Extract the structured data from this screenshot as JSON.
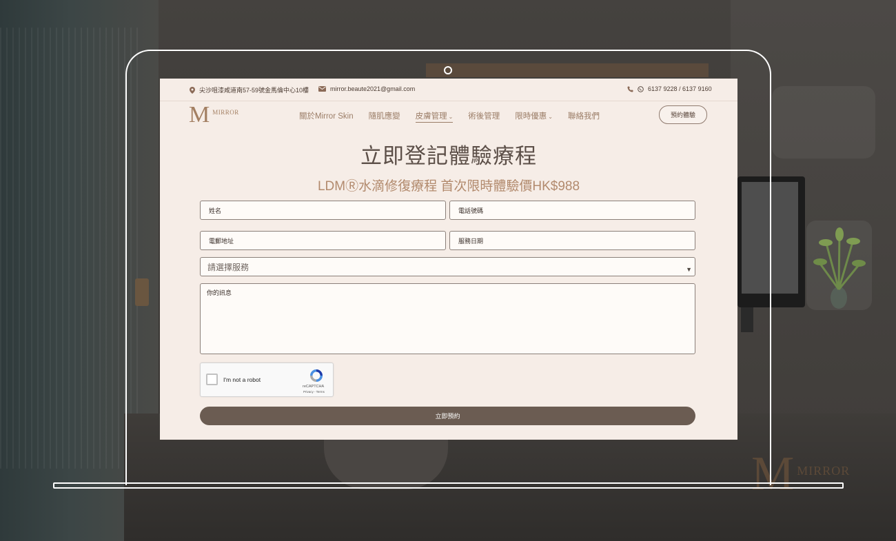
{
  "topbar": {
    "address": "尖沙咀漆咸道南57-59號金馬倫中心10樓",
    "email": "mirror.beaute2021@gmail.com",
    "phones": "6137 9228 / 6137 9160"
  },
  "logo": {
    "letter": "M",
    "text": "MIRROR"
  },
  "nav": {
    "items": [
      {
        "label": "關於Mirror Skin",
        "has_dropdown": false
      },
      {
        "label": "隨肌應變",
        "has_dropdown": false
      },
      {
        "label": "皮膚管理",
        "has_dropdown": true,
        "active": true
      },
      {
        "label": "術後管理",
        "has_dropdown": false
      },
      {
        "label": "限時優惠",
        "has_dropdown": true
      },
      {
        "label": "聯絡我們",
        "has_dropdown": false
      }
    ],
    "book_button": "預約體驗"
  },
  "hero": {
    "title": "立即登記體驗療程",
    "subtitle": "LDMⓇ水滴修復療程 首次限時體驗價HK$988"
  },
  "form": {
    "name_placeholder": "姓名",
    "phone_placeholder": "電話號碼",
    "email_placeholder": "電郵地址",
    "date_placeholder": "服務日期",
    "service_placeholder": "請選擇服務",
    "message_placeholder": "你的訊息",
    "captcha_label": "I'm not a robot",
    "captcha_brand": "reCAPTCHA",
    "captcha_terms": "Privacy - Terms",
    "submit_label": "立即預約"
  },
  "backdrop_logo": {
    "letter": "M",
    "text": "MIRROR"
  },
  "colors": {
    "page_bg": "#f6ede7",
    "accent": "#a37f62",
    "submit_bg": "#6b5c52",
    "text_dark": "#5c4f48"
  }
}
